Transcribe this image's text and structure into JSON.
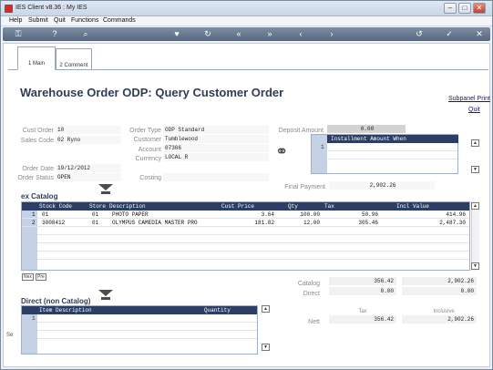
{
  "window": {
    "title": "IES Client v8.36 : My IES"
  },
  "menu": {
    "items": [
      "Help",
      "Submit",
      "Quit",
      "Functions",
      "Commands"
    ]
  },
  "tabs": [
    {
      "label": "1 Main"
    },
    {
      "label": "2 Comment"
    }
  ],
  "page": {
    "title": "Warehouse Order ODP: Query Customer Order",
    "print_link": "Subpanel Print",
    "quit_link": "Quit"
  },
  "header": {
    "cust_order_label": "Cust Order",
    "cust_order": "10",
    "sales_code_label": "Sales Code",
    "sales_code": "02 Ryno",
    "order_date_label": "Order Date",
    "order_date": "19/12/2012",
    "order_status_label": "Order Status",
    "order_status": "OPEN",
    "order_type_label": "Order Type",
    "order_type": "ODP Standard",
    "customer_label": "Customer",
    "customer": "Tumblewood",
    "account_label": "Account",
    "account": "07306",
    "currency_label": "Currency",
    "currency": "LOCAL R",
    "costing_label": "Costing",
    "costing": "",
    "deposit_label": "Deposit Amount",
    "deposit": "0.00",
    "installment_header": "Installment Amount When",
    "installment_row": "1",
    "final_payment_label": "Final Payment",
    "final_payment": "2,902.26"
  },
  "ex_catalog": {
    "title": "ex Catalog",
    "columns": [
      "Stock Code",
      "Store",
      "Description",
      "Cust Price",
      "Qty",
      "Tax",
      "Incl Value"
    ],
    "rows": [
      {
        "num": "1",
        "stock_code": "01",
        "store": "01",
        "description": "PHOTO PAPER",
        "cust_price": "3.64",
        "qty": "100.00",
        "tax": "50.96",
        "incl_value": "414.96"
      },
      {
        "num": "2",
        "stock_code": "3008412",
        "store": "01",
        "description": "OLYMPUS CAMEDIA MASTER PRO",
        "cust_price": "181.82",
        "qty": "12.00",
        "tax": "305.46",
        "incl_value": "2,487.30"
      }
    ],
    "nav_buttons": [
      "Nex",
      "Pre"
    ]
  },
  "direct": {
    "title": "Direct (non Catalog)",
    "columns": [
      "Item Description",
      "Quantity"
    ],
    "rows": [
      {
        "num": "1"
      }
    ]
  },
  "totals": {
    "catalog_label": "Catalog",
    "catalog_tax": "356.42",
    "catalog_incl": "2,902.26",
    "direct_label": "Direct",
    "direct_tax": "0.00",
    "direct_incl": "0.00",
    "tax_header": "Tax",
    "inclusive_header": "Inclusive",
    "nett_label": "Nett",
    "nett_tax": "356.42",
    "nett_incl": "2,902.26"
  },
  "side_label": "Se",
  "colors": {
    "grid_header": "#2c3e63",
    "row_number": "#c5d2e6",
    "title": "#2f3d57",
    "toolbar": "#56667e"
  }
}
